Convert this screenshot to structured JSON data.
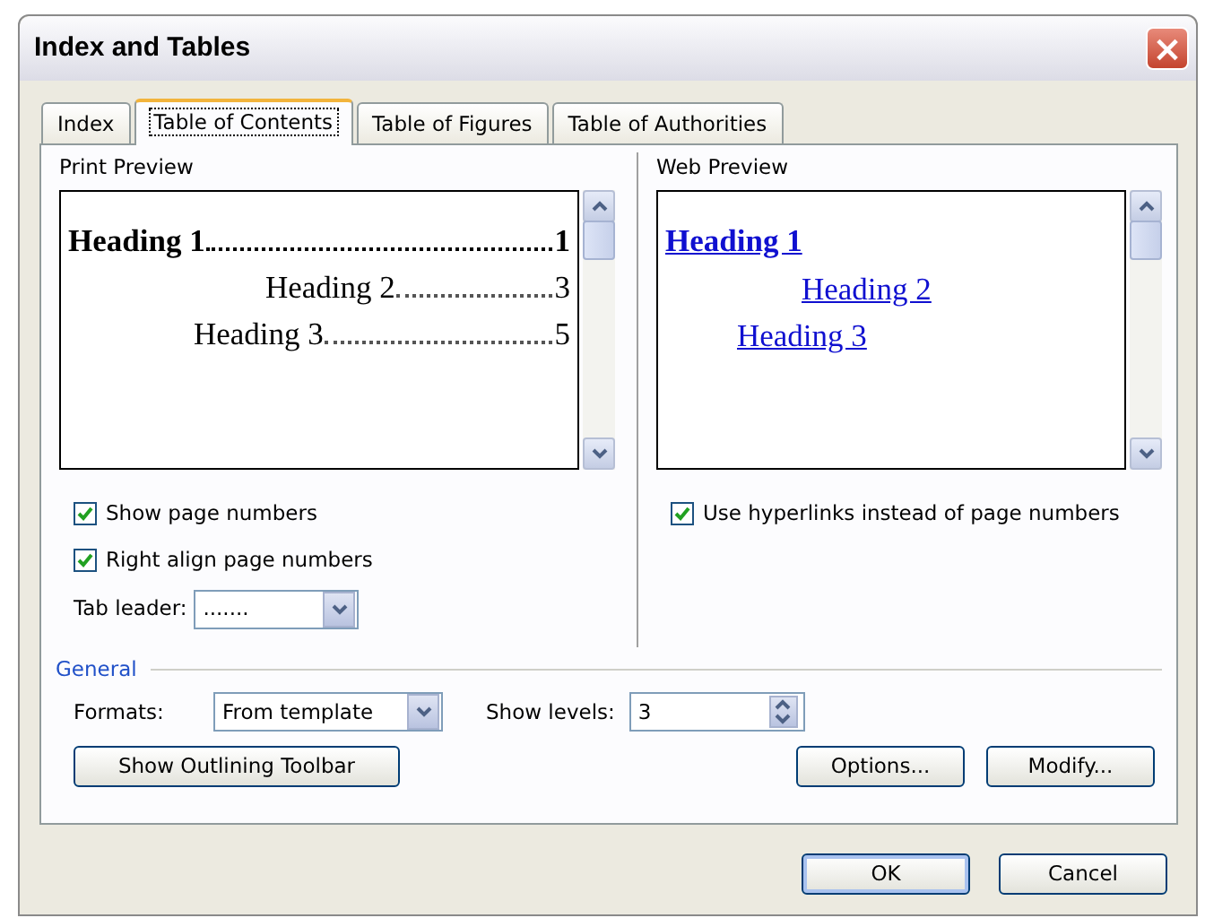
{
  "window": {
    "title": "Index and Tables",
    "close": "×"
  },
  "tabs": [
    {
      "label": "Index",
      "selected": false
    },
    {
      "label": "Table of Contents",
      "selected": true
    },
    {
      "label": "Table of Figures",
      "selected": false
    },
    {
      "label": "Table of Authorities",
      "selected": false
    }
  ],
  "print_preview": {
    "label": "Print Preview",
    "entries": [
      {
        "kind": "h1",
        "text": "Heading 1",
        "page": "1"
      },
      {
        "kind": "h2",
        "text": "Heading 2",
        "page": "3"
      },
      {
        "kind": "h3",
        "text": "Heading 3",
        "page": "5"
      }
    ]
  },
  "web_preview": {
    "label": "Web Preview",
    "entries": [
      {
        "kind": "h1",
        "text": "Heading 1"
      },
      {
        "kind": "h2",
        "text": "Heading 2"
      },
      {
        "kind": "h3",
        "text": "Heading 3"
      }
    ]
  },
  "print_options": [
    {
      "label": "Show page numbers",
      "checked": true
    },
    {
      "label": "Right align page numbers",
      "checked": true
    }
  ],
  "web_options": [
    {
      "label": "Use hyperlinks instead of page numbers",
      "checked": true
    }
  ],
  "tab_leader": {
    "label": "Tab leader:",
    "value": "......."
  },
  "general": {
    "label": "General",
    "formats_label": "Formats:",
    "formats_value": "From template",
    "levels_label": "Show levels:",
    "levels_value": "3"
  },
  "panel_buttons": [
    "Show Outlining Toolbar",
    "Options...",
    "Modify..."
  ],
  "dialog_buttons": [
    "OK",
    "Cancel"
  ]
}
